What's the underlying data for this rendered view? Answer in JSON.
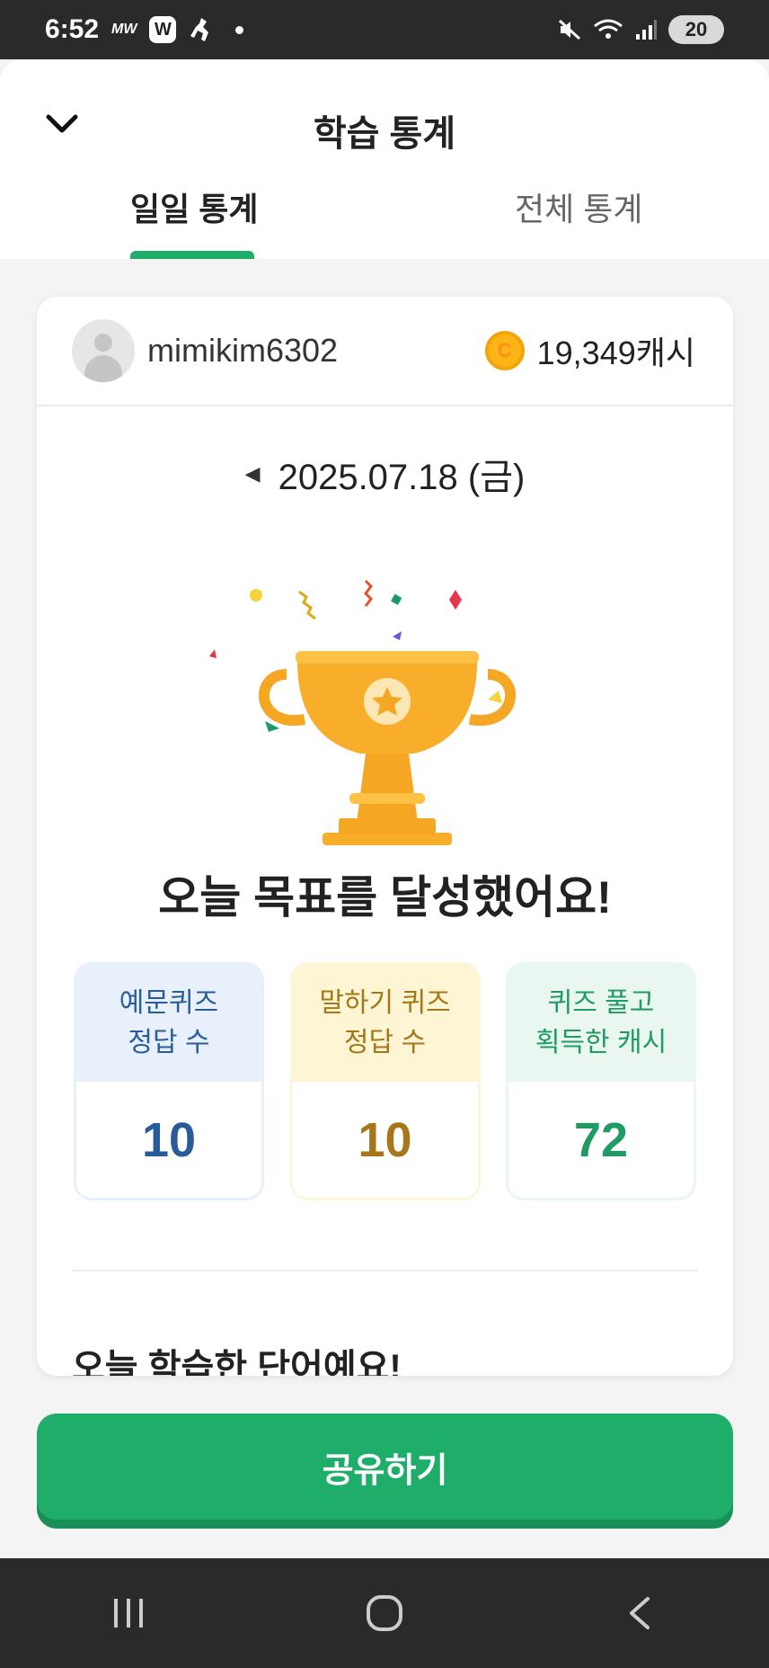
{
  "status_bar": {
    "time": "6:52",
    "mw_label": "MW",
    "w_label": "W",
    "battery": "20",
    "icons": [
      "mute-icon",
      "wifi-icon",
      "signal-icon",
      "battery-icon"
    ]
  },
  "header": {
    "title": "학습 통계",
    "tabs": [
      {
        "label": "일일 통계",
        "active": true
      },
      {
        "label": "전체 통계",
        "active": false
      }
    ],
    "accent_color": "#1fae6a"
  },
  "card": {
    "username": "mimikim6302",
    "cash": "19,349캐시",
    "coin_letter": "C",
    "date": "2025.07.18 (금)",
    "headline": "오늘 목표를 달성했어요!",
    "stats": [
      {
        "label_line1": "예문퀴즈",
        "label_line2": "정답 수",
        "value": "10",
        "color": "#2a5c9c"
      },
      {
        "label_line1": "말하기 퀴즈",
        "label_line2": "정답 수",
        "value": "10",
        "color": "#a57716"
      },
      {
        "label_line1": "퀴즈 풀고",
        "label_line2": "획득한 캐시",
        "value": "72",
        "color": "#1f9b63"
      }
    ],
    "section_heading": "오늘 학습한 단어예요!"
  },
  "share_button": {
    "label": "공유하기"
  },
  "nav": {
    "icons": [
      "recent-apps-icon",
      "home-icon",
      "back-icon"
    ]
  }
}
